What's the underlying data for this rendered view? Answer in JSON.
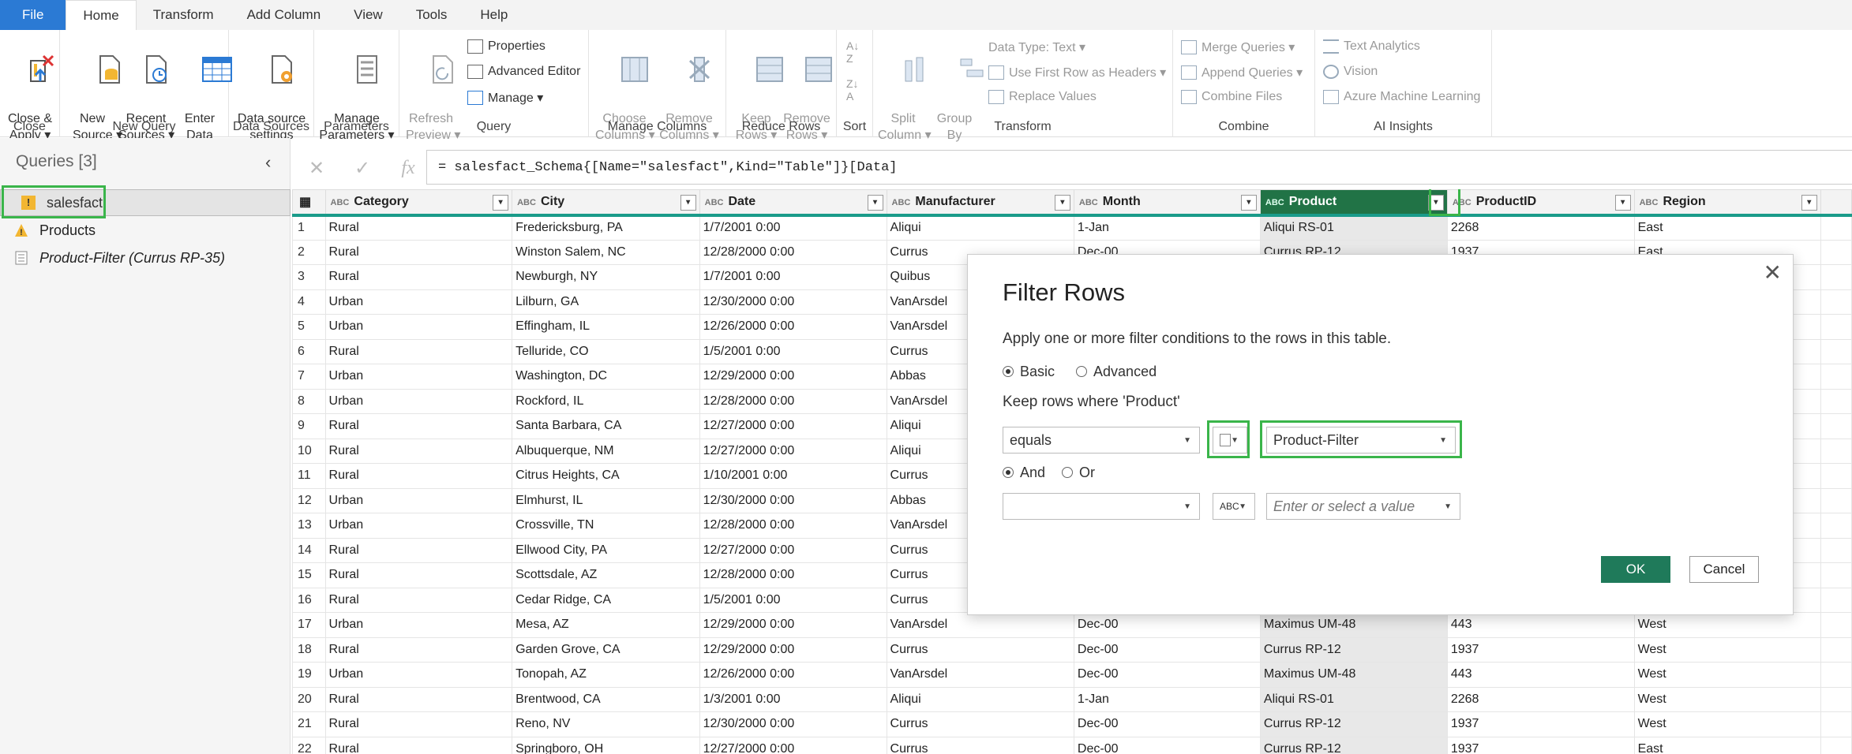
{
  "menu": {
    "tabs": [
      "File",
      "Home",
      "Transform",
      "Add Column",
      "View",
      "Tools",
      "Help"
    ]
  },
  "ribbon": {
    "close": {
      "button": "Close &\nApply ▾",
      "group": "Close"
    },
    "newquery": {
      "new_source": "New\nSource ▾",
      "recent_sources": "Recent\nSources ▾",
      "enter_data": "Enter\nData",
      "group": "New Query"
    },
    "datasources": {
      "settings": "Data source\nsettings",
      "group": "Data Sources"
    },
    "parameters": {
      "manage": "Manage\nParameters ▾",
      "group": "Parameters"
    },
    "query": {
      "refresh": "Refresh\nPreview ▾",
      "properties": "Properties",
      "advanced_editor": "Advanced Editor",
      "manage": "Manage ▾",
      "group": "Query"
    },
    "managecols": {
      "choose": "Choose\nColumns ▾",
      "remove": "Remove\nColumns ▾",
      "group": "Manage Columns"
    },
    "reducerows": {
      "keep": "Keep\nRows ▾",
      "remove": "Remove\nRows ▾",
      "group": "Reduce Rows"
    },
    "sort": {
      "group": "Sort"
    },
    "transform": {
      "split": "Split\nColumn ▾",
      "groupby": "Group\nBy",
      "datatype": "Data Type: Text ▾",
      "firstrow": "Use First Row as Headers ▾",
      "replace": "Replace Values",
      "group": "Transform"
    },
    "combine": {
      "merge": "Merge Queries ▾",
      "append": "Append Queries ▾",
      "files": "Combine Files",
      "group": "Combine"
    },
    "ai": {
      "text": "Text Analytics",
      "vision": "Vision",
      "azure": "Azure Machine Learning",
      "group": "AI Insights"
    }
  },
  "queries": {
    "title": "Queries [3]",
    "items": [
      "salesfact",
      "Products",
      "Product-Filter (Currus RP-35)"
    ]
  },
  "formula": "= salesfact_Schema{[Name=\"salesfact\",Kind=\"Table\"]}[Data]",
  "columns": [
    "Category",
    "City",
    "Date",
    "Manufacturer",
    "Month",
    "Product",
    "ProductID",
    "Region"
  ],
  "rows": [
    [
      "1",
      "Rural",
      "Fredericksburg, PA",
      "1/7/2001 0:00",
      "Aliqui",
      "1-Jan",
      "Aliqui RS-01",
      "2268",
      "East"
    ],
    [
      "2",
      "Rural",
      "Winston Salem, NC",
      "12/28/2000 0:00",
      "Currus",
      "Dec-00",
      "Currus RP-12",
      "1937",
      "East"
    ],
    [
      "3",
      "Rural",
      "Newburgh, NY",
      "1/7/2001 0:00",
      "Quibus",
      "",
      "",
      "",
      ""
    ],
    [
      "4",
      "Urban",
      "Lilburn, GA",
      "12/30/2000 0:00",
      "VanArsdel",
      "",
      "",
      "",
      ""
    ],
    [
      "5",
      "Urban",
      "Effingham, IL",
      "12/26/2000 0:00",
      "VanArsdel",
      "",
      "",
      "",
      ""
    ],
    [
      "6",
      "Rural",
      "Telluride, CO",
      "1/5/2001 0:00",
      "Currus",
      "",
      "",
      "",
      ""
    ],
    [
      "7",
      "Urban",
      "Washington, DC",
      "12/29/2000 0:00",
      "Abbas",
      "",
      "",
      "",
      ""
    ],
    [
      "8",
      "Urban",
      "Rockford, IL",
      "12/28/2000 0:00",
      "VanArsdel",
      "",
      "",
      "",
      ""
    ],
    [
      "9",
      "Rural",
      "Santa Barbara, CA",
      "12/27/2000 0:00",
      "Aliqui",
      "",
      "",
      "",
      ""
    ],
    [
      "10",
      "Rural",
      "Albuquerque, NM",
      "12/27/2000 0:00",
      "Aliqui",
      "",
      "",
      "",
      ""
    ],
    [
      "11",
      "Rural",
      "Citrus Heights, CA",
      "1/10/2001 0:00",
      "Currus",
      "",
      "",
      "",
      ""
    ],
    [
      "12",
      "Urban",
      "Elmhurst, IL",
      "12/30/2000 0:00",
      "Abbas",
      "",
      "",
      "",
      ""
    ],
    [
      "13",
      "Urban",
      "Crossville, TN",
      "12/28/2000 0:00",
      "VanArsdel",
      "",
      "",
      "",
      ""
    ],
    [
      "14",
      "Rural",
      "Ellwood City, PA",
      "12/27/2000 0:00",
      "Currus",
      "",
      "",
      "",
      ""
    ],
    [
      "15",
      "Rural",
      "Scottsdale, AZ",
      "12/28/2000 0:00",
      "Currus",
      "",
      "",
      "",
      ""
    ],
    [
      "16",
      "Rural",
      "Cedar Ridge, CA",
      "1/5/2001 0:00",
      "Currus",
      "",
      "",
      "",
      ""
    ],
    [
      "17",
      "Urban",
      "Mesa, AZ",
      "12/29/2000 0:00",
      "VanArsdel",
      "Dec-00",
      "Maximus UM-48",
      "443",
      "West"
    ],
    [
      "18",
      "Rural",
      "Garden Grove, CA",
      "12/29/2000 0:00",
      "Currus",
      "Dec-00",
      "Currus RP-12",
      "1937",
      "West"
    ],
    [
      "19",
      "Urban",
      "Tonopah, AZ",
      "12/26/2000 0:00",
      "VanArsdel",
      "Dec-00",
      "Maximus UM-48",
      "443",
      "West"
    ],
    [
      "20",
      "Rural",
      "Brentwood, CA",
      "1/3/2001 0:00",
      "Aliqui",
      "1-Jan",
      "Aliqui RS-01",
      "2268",
      "West"
    ],
    [
      "21",
      "Rural",
      "Reno, NV",
      "12/30/2000 0:00",
      "Currus",
      "Dec-00",
      "Currus RP-12",
      "1937",
      "West"
    ],
    [
      "22",
      "Rural",
      "Springboro, OH",
      "12/27/2000 0:00",
      "Currus",
      "Dec-00",
      "Currus RP-12",
      "1937",
      "East"
    ]
  ],
  "dialog": {
    "title": "Filter Rows",
    "description": "Apply one or more filter conditions to the rows in this table.",
    "basic": "Basic",
    "advanced": "Advanced",
    "keep_label": "Keep rows where 'Product'",
    "operator1": "equals",
    "value1": "Product-Filter",
    "and": "And",
    "or": "Or",
    "value2_placeholder": "Enter or select a value",
    "ok": "OK",
    "cancel": "Cancel"
  },
  "colors": {
    "accent": "#217346",
    "highlight": "#3ab54a",
    "file_tab": "#2b7ad4"
  }
}
